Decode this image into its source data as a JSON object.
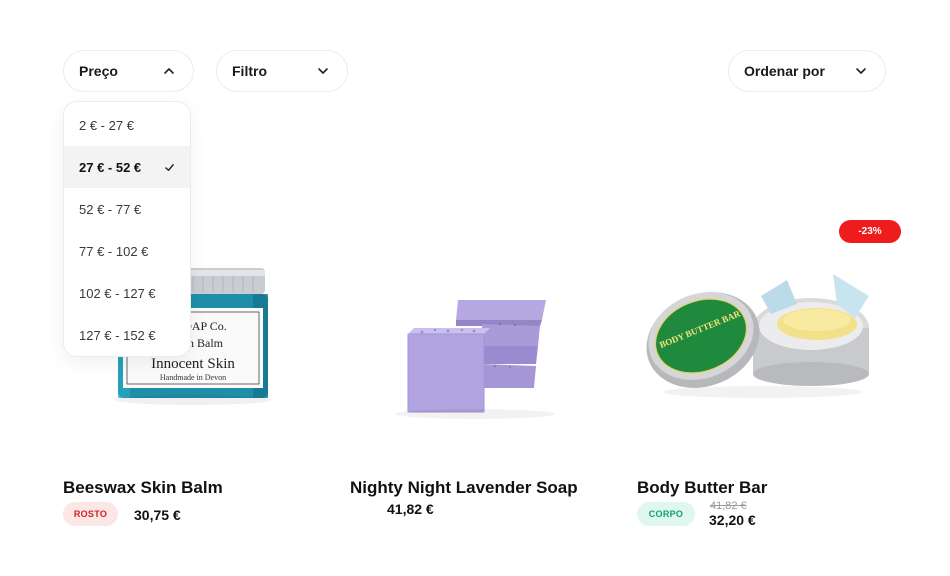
{
  "filters": {
    "price_label": "Preço",
    "filter_label": "Filtro",
    "sort_label": "Ordenar por"
  },
  "price_options": [
    {
      "label": "2 € - 27 €",
      "selected": false
    },
    {
      "label": "27 € - 52 €",
      "selected": true
    },
    {
      "label": "52 € - 77 €",
      "selected": false
    },
    {
      "label": "77 € - 102 €",
      "selected": false
    },
    {
      "label": "102 € - 127 €",
      "selected": false
    },
    {
      "label": "127 € - 152 €",
      "selected": false
    }
  ],
  "products": [
    {
      "name": "Beeswax Skin Balm",
      "tag": "ROSTO",
      "price": "30,75 €",
      "jar_label": [
        "LY SOAP Co.",
        "g Skin Balm",
        "Innocent Skin",
        "Handmade in Devon"
      ]
    },
    {
      "name": "Nighty Night Lavender Soap",
      "price": "41,82 €"
    },
    {
      "name": "Body Butter Bar",
      "tag": "CORPO",
      "old_price": "41,82 €",
      "price": "32,20 €",
      "discount": "-23%",
      "tin_label": "BODY BUTTER BAR"
    }
  ],
  "colors": {
    "accent_red": "#ee1c1c",
    "rosto_bg": "#fde6e6",
    "corpo_bg": "#dff7ee",
    "lavender": "#a99bd8",
    "tin_green": "#1f8a3d"
  }
}
